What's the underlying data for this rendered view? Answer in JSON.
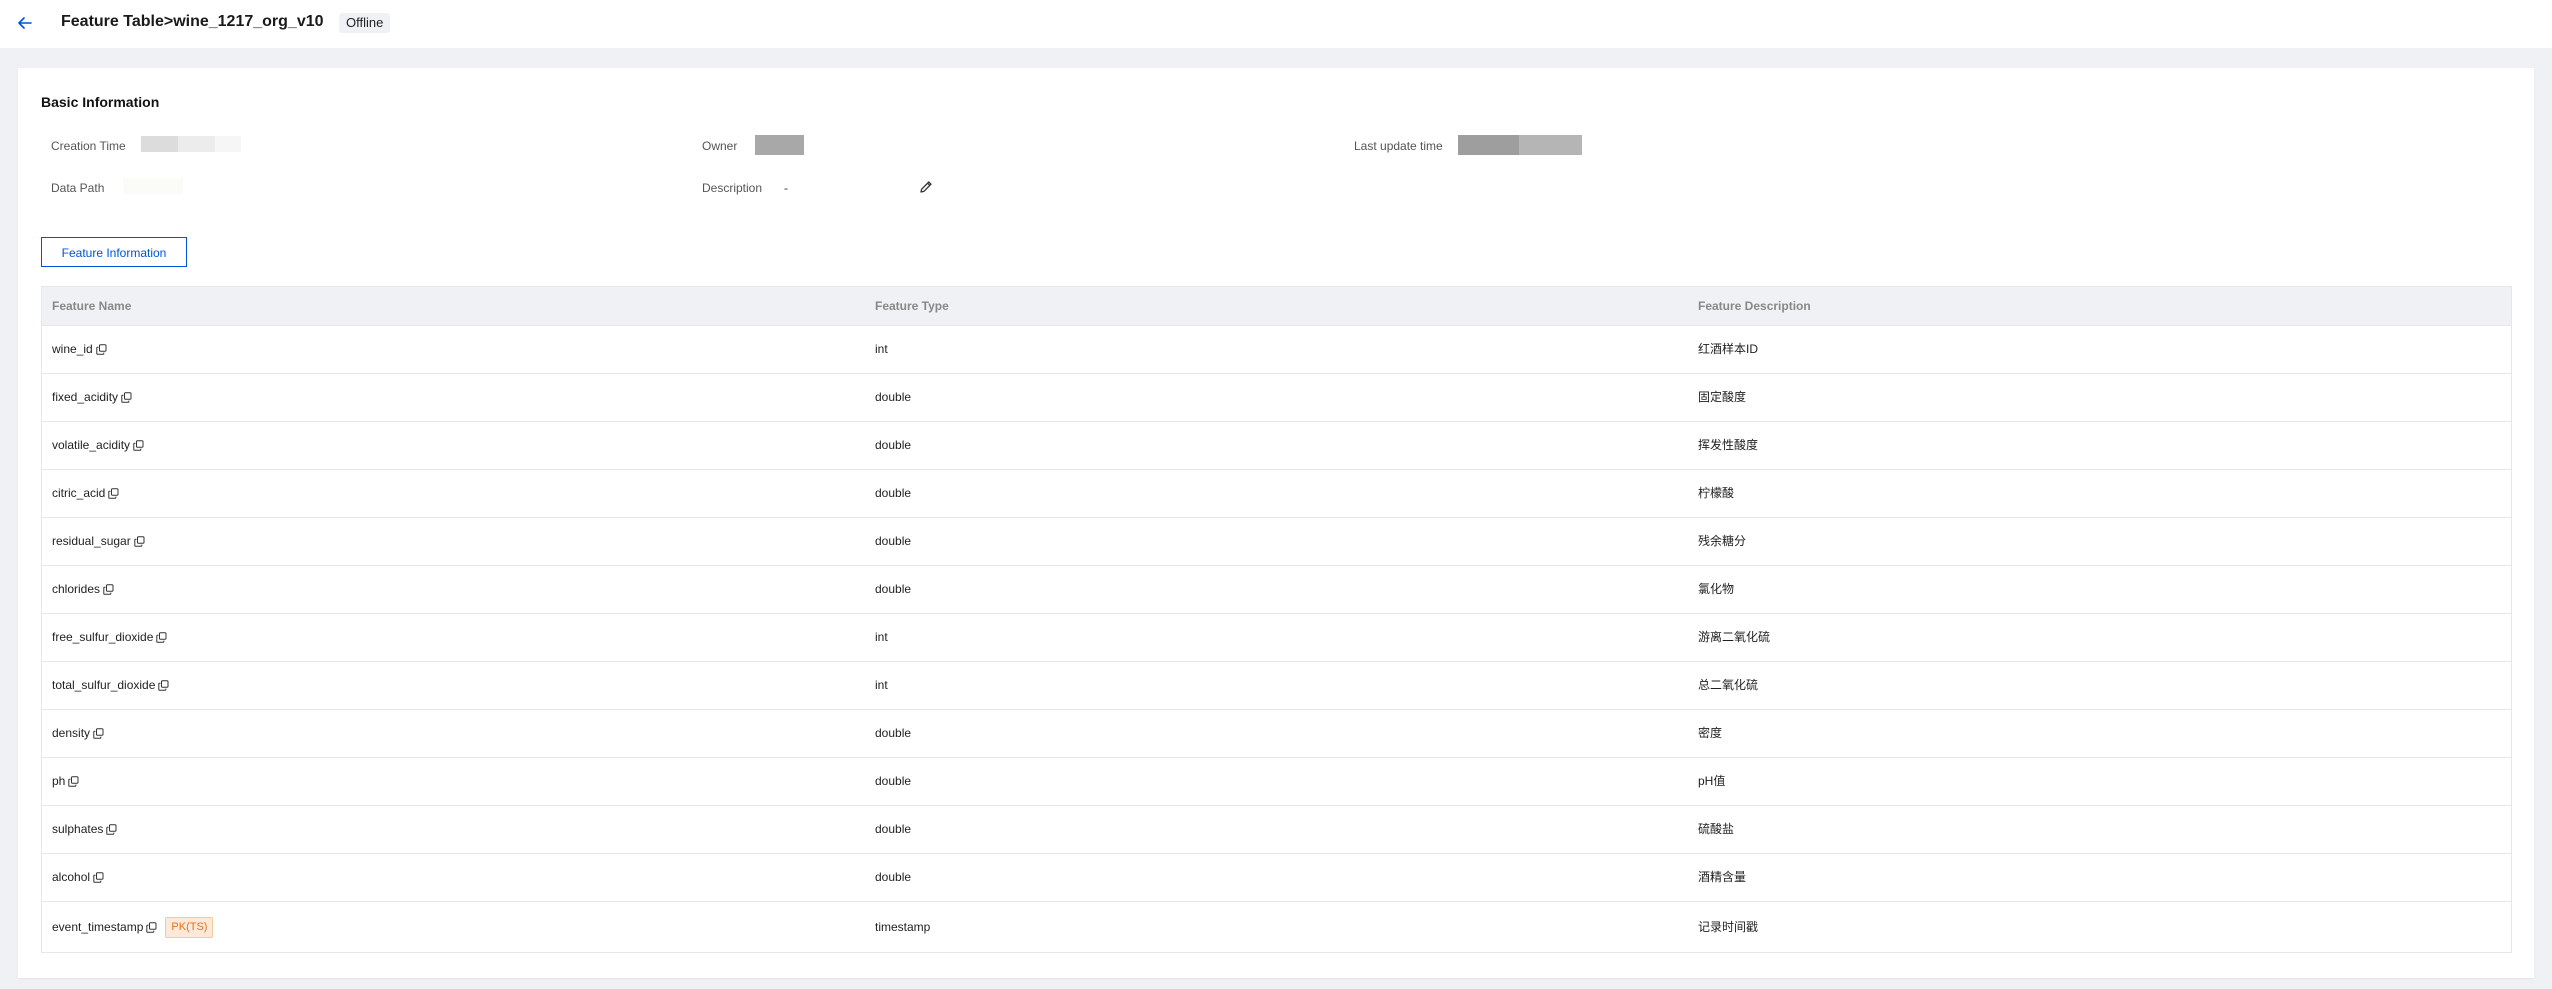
{
  "header": {
    "title": "Feature Table>wine_1217_org_v10",
    "status": "Offline"
  },
  "basic_info": {
    "section_title": "Basic Information",
    "creation_time_label": "Creation Time",
    "owner_label": "Owner",
    "last_update_label": "Last update time",
    "data_path_label": "Data Path",
    "description_label": "Description",
    "description_value": "-"
  },
  "tabs": {
    "feature_information": "Feature Information"
  },
  "table": {
    "columns": [
      "Feature Name",
      "Feature Type",
      "Feature Description"
    ],
    "rows": [
      {
        "name": "wine_id",
        "type": "int",
        "desc": "红酒样本ID",
        "tag": ""
      },
      {
        "name": "fixed_acidity",
        "type": "double",
        "desc": "固定酸度",
        "tag": ""
      },
      {
        "name": "volatile_acidity",
        "type": "double",
        "desc": "挥发性酸度",
        "tag": ""
      },
      {
        "name": "citric_acid",
        "type": "double",
        "desc": "柠檬酸",
        "tag": ""
      },
      {
        "name": "residual_sugar",
        "type": "double",
        "desc": "残余糖分",
        "tag": ""
      },
      {
        "name": "chlorides",
        "type": "double",
        "desc": "氯化物",
        "tag": ""
      },
      {
        "name": "free_sulfur_dioxide",
        "type": "int",
        "desc": "游离二氧化硫",
        "tag": ""
      },
      {
        "name": "total_sulfur_dioxide",
        "type": "int",
        "desc": "总二氧化硫",
        "tag": ""
      },
      {
        "name": "density",
        "type": "double",
        "desc": "密度",
        "tag": ""
      },
      {
        "name": "ph",
        "type": "double",
        "desc": "pH值",
        "tag": ""
      },
      {
        "name": "sulphates",
        "type": "double",
        "desc": "硫酸盐",
        "tag": ""
      },
      {
        "name": "alcohol",
        "type": "double",
        "desc": "酒精含量",
        "tag": ""
      },
      {
        "name": "event_timestamp",
        "type": "timestamp",
        "desc": "记录时间戳",
        "tag": "PK(TS)"
      }
    ]
  },
  "colors": {
    "accent": "#0052d9",
    "tag_orange": "#e37318",
    "page_bg": "#f0f1f4"
  },
  "icons": {
    "back": "arrow-left-icon",
    "edit": "pencil-icon",
    "copy": "copy-icon"
  }
}
